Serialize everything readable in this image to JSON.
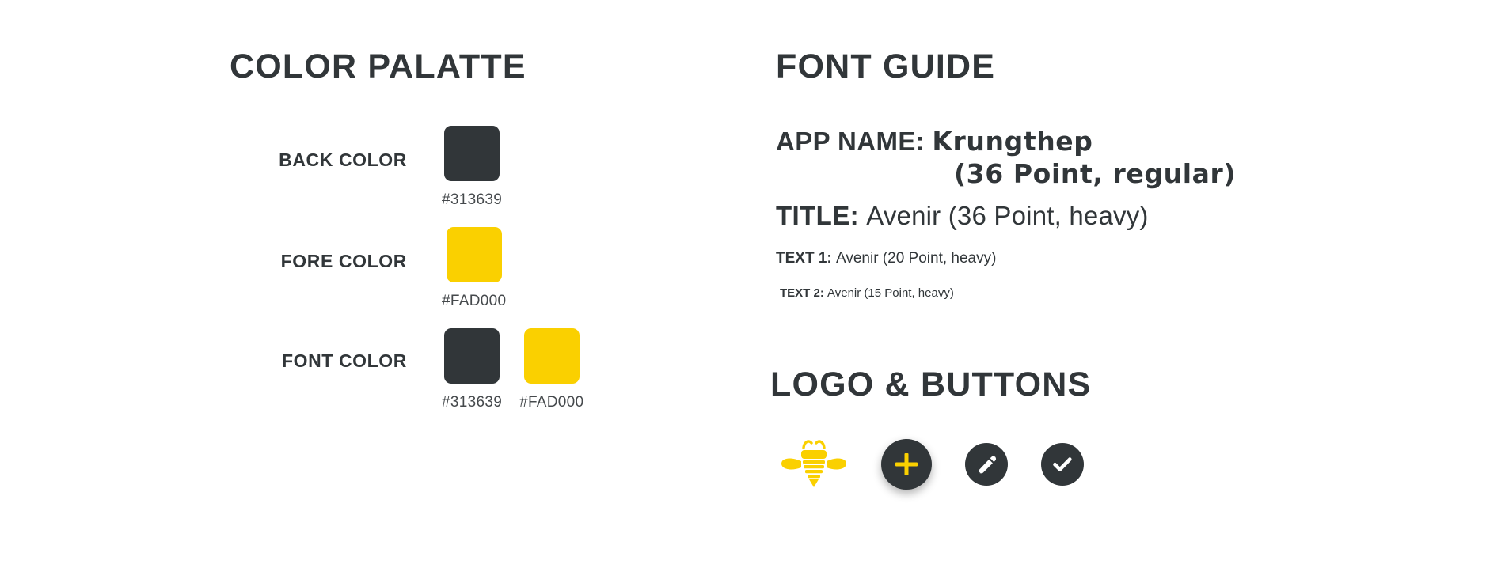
{
  "palette": {
    "title": "COLOR PALATTE",
    "rows": [
      {
        "label": "BACK COLOR",
        "swatches": [
          {
            "hex": "#313639",
            "color": "#313639"
          }
        ]
      },
      {
        "label": "FORE COLOR",
        "swatches": [
          {
            "hex": "#FAD000",
            "color": "#FAD000"
          }
        ]
      },
      {
        "label": "FONT COLOR",
        "swatches": [
          {
            "hex": "#313639",
            "color": "#313639"
          },
          {
            "hex": "#FAD000",
            "color": "#FAD000"
          }
        ]
      }
    ]
  },
  "font_guide": {
    "title": "FONT GUIDE",
    "app_name_label": "APP NAME:",
    "app_name_value": "Krungthep",
    "app_name_size": "(36 Point, regular)",
    "title_label": "TITLE:",
    "title_value": "Avenir (36 Point, heavy)",
    "text1_label": "TEXT 1:",
    "text1_value": "Avenir (20 Point, heavy)",
    "text2_label": "TEXT 2:",
    "text2_value": "Avenir (15 Point, heavy)"
  },
  "logo_buttons": {
    "title": "LOGO & BUTTONS",
    "items": [
      {
        "name": "bee-logo",
        "type": "logo",
        "color": "#FAD000"
      },
      {
        "name": "add-button",
        "type": "button",
        "glyph": "plus",
        "bg": "#313639",
        "fg": "#FAD000"
      },
      {
        "name": "edit-button",
        "type": "button",
        "glyph": "pencil",
        "bg": "#313639",
        "fg": "#FFFFFF"
      },
      {
        "name": "done-button",
        "type": "button",
        "glyph": "check",
        "bg": "#313639",
        "fg": "#FFFFFF"
      }
    ]
  }
}
